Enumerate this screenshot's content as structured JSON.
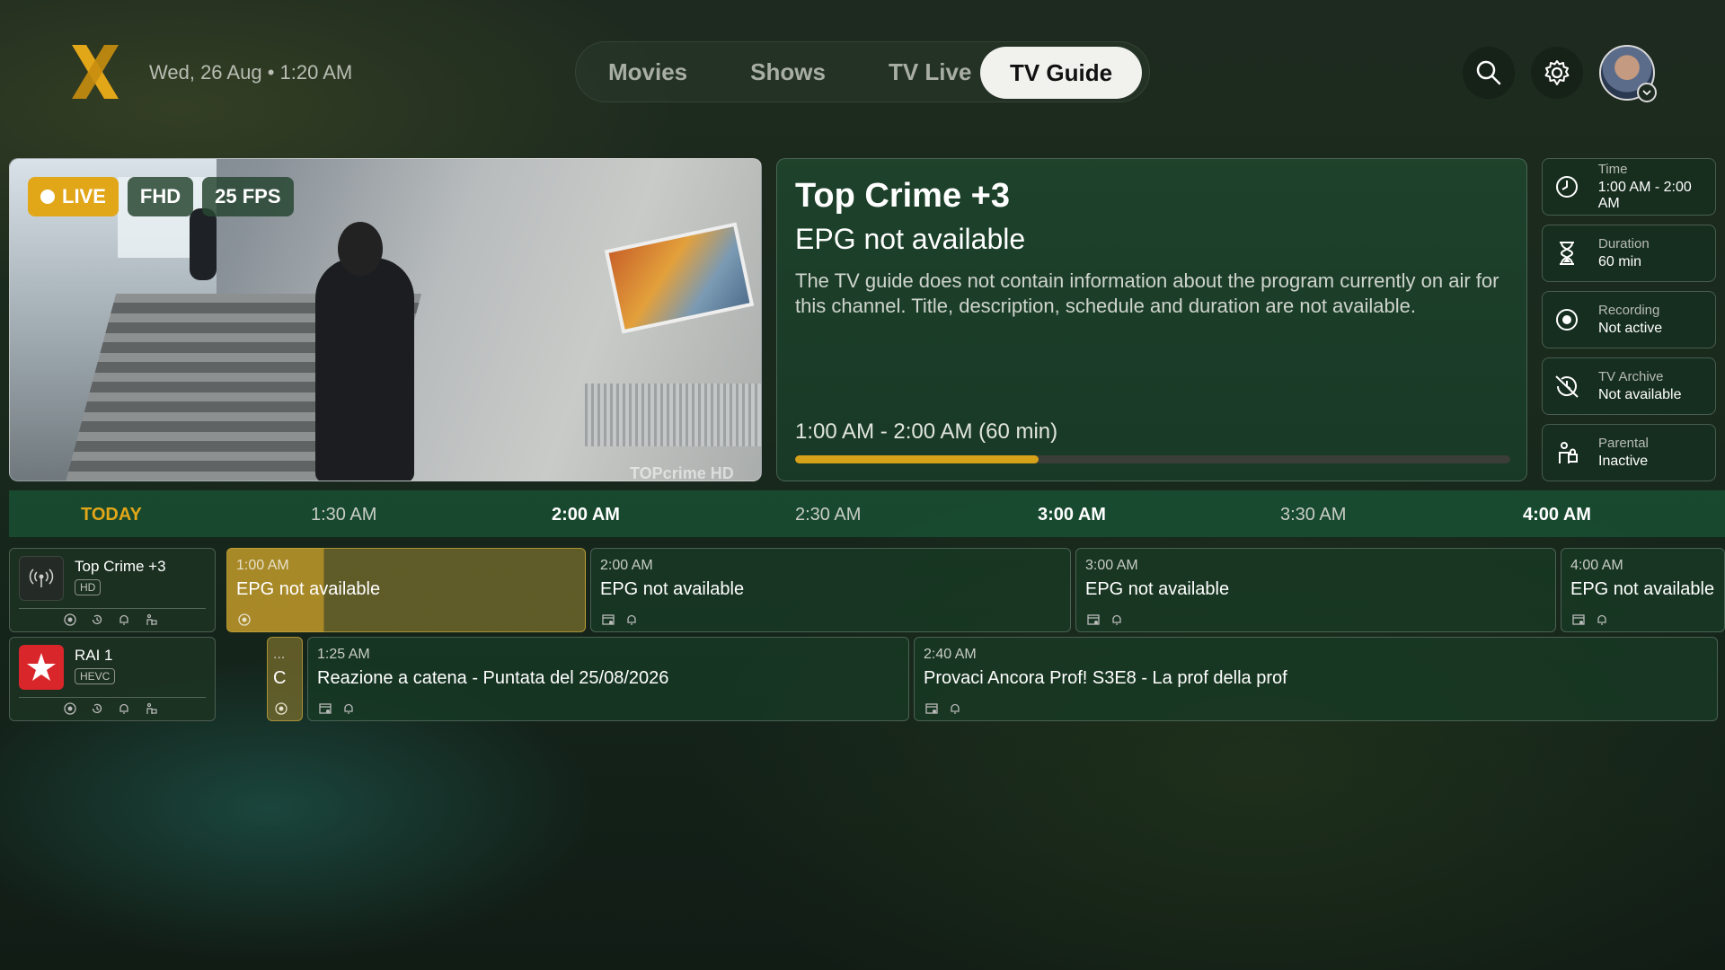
{
  "header": {
    "datetime": "Wed, 26 Aug • 1:20 AM",
    "nav": [
      "Movies",
      "Shows",
      "TV Live",
      "TV Guide"
    ],
    "active_nav": "TV Guide"
  },
  "player": {
    "badges": {
      "live": "LIVE",
      "quality": "FHD",
      "fps": "25 FPS"
    },
    "watermark": "TOPcrime HD"
  },
  "info": {
    "channel": "Top Crime +3",
    "title": "EPG not available",
    "description": "The TV guide does not contain information about the program currently on air for this channel. Title, description, schedule and duration are not available.",
    "time_range": "1:00 AM - 2:00 AM  (60 min)",
    "progress_percent": 34
  },
  "side": [
    {
      "label": "Time",
      "value": "1:00 AM - 2:00 AM",
      "icon": "clock-icon"
    },
    {
      "label": "Duration",
      "value": "60 min",
      "icon": "hourglass-icon"
    },
    {
      "label": "Recording",
      "value": "Not active",
      "icon": "record-icon"
    },
    {
      "label": "TV Archive",
      "value": "Not available",
      "icon": "archive-off-icon"
    },
    {
      "label": "Parental",
      "value": "Inactive",
      "icon": "parental-icon"
    }
  ],
  "timeline": {
    "today": "TODAY",
    "labels": [
      "1:30 AM",
      "2:00 AM",
      "2:30 AM",
      "3:00 AM",
      "3:30 AM",
      "4:00 AM"
    ]
  },
  "channels": [
    {
      "name": "Top Crime +3",
      "tag": "HD",
      "programs": [
        {
          "time": "1:00 AM",
          "title": "EPG not available"
        },
        {
          "time": "2:00 AM",
          "title": "EPG not available"
        },
        {
          "time": "3:00 AM",
          "title": "EPG not available"
        },
        {
          "time": "4:00 AM",
          "title": "EPG not available"
        }
      ]
    },
    {
      "name": "RAI 1",
      "tag": "HEVC",
      "programs": [
        {
          "time": "...",
          "title": "C"
        },
        {
          "time": "1:25 AM",
          "title": "Reazione a catena - Puntata del 25/08/2026"
        },
        {
          "time": "2:40 AM",
          "title": "Provaci Ancora Prof! S3E8 - La prof della prof"
        }
      ]
    }
  ]
}
